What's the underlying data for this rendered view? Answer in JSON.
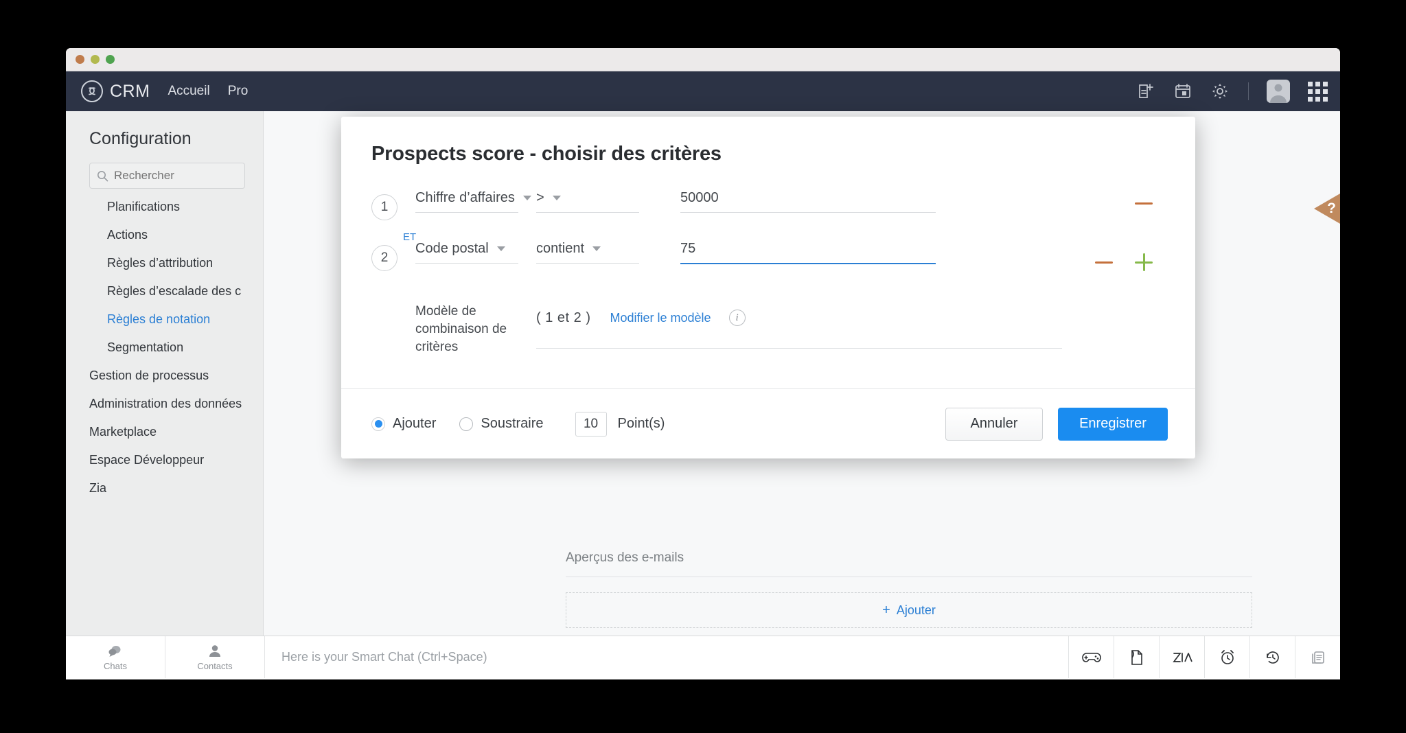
{
  "window": {
    "traffic_lights": [
      "close",
      "minimize",
      "zoom"
    ]
  },
  "header": {
    "logo_text": "CRM",
    "nav": [
      {
        "label": "Accueil"
      },
      {
        "label": "Pro"
      }
    ],
    "icons": [
      {
        "name": "new-note-icon"
      },
      {
        "name": "calendar-icon"
      },
      {
        "name": "gear-icon"
      },
      {
        "name": "avatar"
      },
      {
        "name": "apps-grid-icon"
      }
    ]
  },
  "sidebar": {
    "title": "Configuration",
    "search": {
      "placeholder": "Rechercher",
      "value": ""
    },
    "items": [
      {
        "label": "Planifications",
        "indent": true,
        "active": false
      },
      {
        "label": "Actions",
        "indent": true,
        "active": false
      },
      {
        "label": "Règles d’attribution",
        "indent": true,
        "active": false
      },
      {
        "label": "Règles d’escalade des c",
        "indent": true,
        "active": false
      },
      {
        "label": "Règles de notation",
        "indent": true,
        "active": true
      },
      {
        "label": "Segmentation",
        "indent": true,
        "active": false
      },
      {
        "label": "Gestion de processus",
        "indent": false,
        "active": false
      },
      {
        "label": "Administration des données",
        "indent": false,
        "active": false
      },
      {
        "label": "Marketplace",
        "indent": false,
        "active": false
      },
      {
        "label": "Espace Développeur",
        "indent": false,
        "active": false
      },
      {
        "label": "Zia",
        "indent": false,
        "active": false
      }
    ]
  },
  "main": {
    "email_section_title": "Aperçus des e-mails",
    "add_label": "Ajouter",
    "add_plus": "+",
    "help_tab_label": "?"
  },
  "modal": {
    "title": "Prospects score - choisir des critères",
    "criteria": [
      {
        "number": "1",
        "field": "Chiffre d’affaires",
        "operator": ">",
        "value": "50000",
        "value_focused": false,
        "connector": "ET",
        "has_remove": true,
        "has_add": false
      },
      {
        "number": "2",
        "field": "Code postal",
        "operator": "contient",
        "value": "75",
        "value_focused": true,
        "connector": "",
        "has_remove": true,
        "has_add": true
      }
    ],
    "combination": {
      "label": "Modèle de combinaison de critères",
      "expression": "( 1 et 2 )",
      "edit_link": "Modifier le modèle",
      "info_glyph": "i"
    },
    "footer": {
      "add_label": "Ajouter",
      "subtract_label": "Soustraire",
      "mode_selected": "Ajouter",
      "points_value": "10",
      "points_label": "Point(s)",
      "cancel_label": "Annuler",
      "save_label": "Enregistrer"
    }
  },
  "statusbar": {
    "tabs": [
      {
        "label": "Chats",
        "icon": "chat-bubble-icon"
      },
      {
        "label": "Contacts",
        "icon": "person-icon"
      }
    ],
    "smart_chat_placeholder": "Here is your Smart Chat (Ctrl+Space)",
    "icons": [
      {
        "name": "gamepad-icon"
      },
      {
        "name": "note-flip-icon"
      },
      {
        "name": "zia-icon"
      },
      {
        "name": "alarm-clock-icon"
      },
      {
        "name": "history-clock-icon"
      },
      {
        "name": "notes-stack-icon"
      }
    ]
  },
  "colors": {
    "accent": "#2b7fd4",
    "save_button": "#1a8cf0",
    "header_bg": "#2c3345",
    "remove": "#c4703c",
    "add": "#86b94a",
    "help_tab": "#c08a5e"
  }
}
